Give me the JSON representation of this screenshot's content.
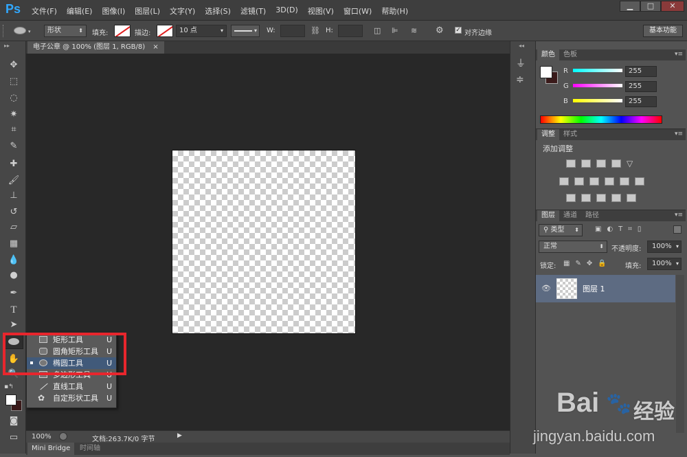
{
  "app": {
    "logo": "Ps"
  },
  "menu": {
    "items": [
      "文件(F)",
      "编辑(E)",
      "图像(I)",
      "图层(L)",
      "文字(Y)",
      "选择(S)",
      "滤镜(T)",
      "3D(D)",
      "视图(V)",
      "窗口(W)",
      "帮助(H)"
    ]
  },
  "window_controls": {
    "minimize": "▁",
    "maximize": "□",
    "close": "✕"
  },
  "options": {
    "mode": "形状",
    "fill_label": "填充:",
    "stroke_label": "描边:",
    "stroke_size": "10 点",
    "w_label": "W:",
    "h_label": "H:",
    "align_edges": "对齐边缘",
    "workspace": "基本功能"
  },
  "document": {
    "tab_title": "电子公章 @ 100% (图层 1, RGB/8)",
    "tab_close": "×",
    "zoom": "100%",
    "doc_info": "文档:263.7K/0 字节"
  },
  "bottom_tabs": [
    "Mini Bridge",
    "时间轴"
  ],
  "flyout": {
    "items": [
      {
        "label": "矩形工具",
        "key": "U",
        "selected": false
      },
      {
        "label": "圆角矩形工具",
        "key": "U",
        "selected": false
      },
      {
        "label": "椭圆工具",
        "key": "U",
        "selected": true
      },
      {
        "label": "多边形工具",
        "key": "U",
        "selected": false
      },
      {
        "label": "直线工具",
        "key": "U",
        "selected": false
      },
      {
        "label": "自定形状工具",
        "key": "U",
        "selected": false
      }
    ]
  },
  "color_panel": {
    "tabs": [
      "颜色",
      "色板"
    ],
    "channels": [
      {
        "label": "R",
        "value": "255"
      },
      {
        "label": "G",
        "value": "255"
      },
      {
        "label": "B",
        "value": "255"
      }
    ]
  },
  "adjustments_panel": {
    "tabs": [
      "调整",
      "样式"
    ],
    "title": "添加调整"
  },
  "layers_panel": {
    "tabs": [
      "图层",
      "通道",
      "路径"
    ],
    "filter_type": "类型",
    "blend_mode": "正常",
    "opacity_label": "不透明度:",
    "opacity": "100%",
    "lock_label": "锁定:",
    "fill_label": "填充:",
    "fill": "100%",
    "layer_name": "图层 1"
  },
  "watermark": {
    "brand": "Bai",
    "brand_cn": "经验",
    "url": "jingyan.baidu.com"
  },
  "colors": {
    "accent": "#31a8ff",
    "highlight": "#e8262d",
    "selected_row": "#415a7a"
  }
}
